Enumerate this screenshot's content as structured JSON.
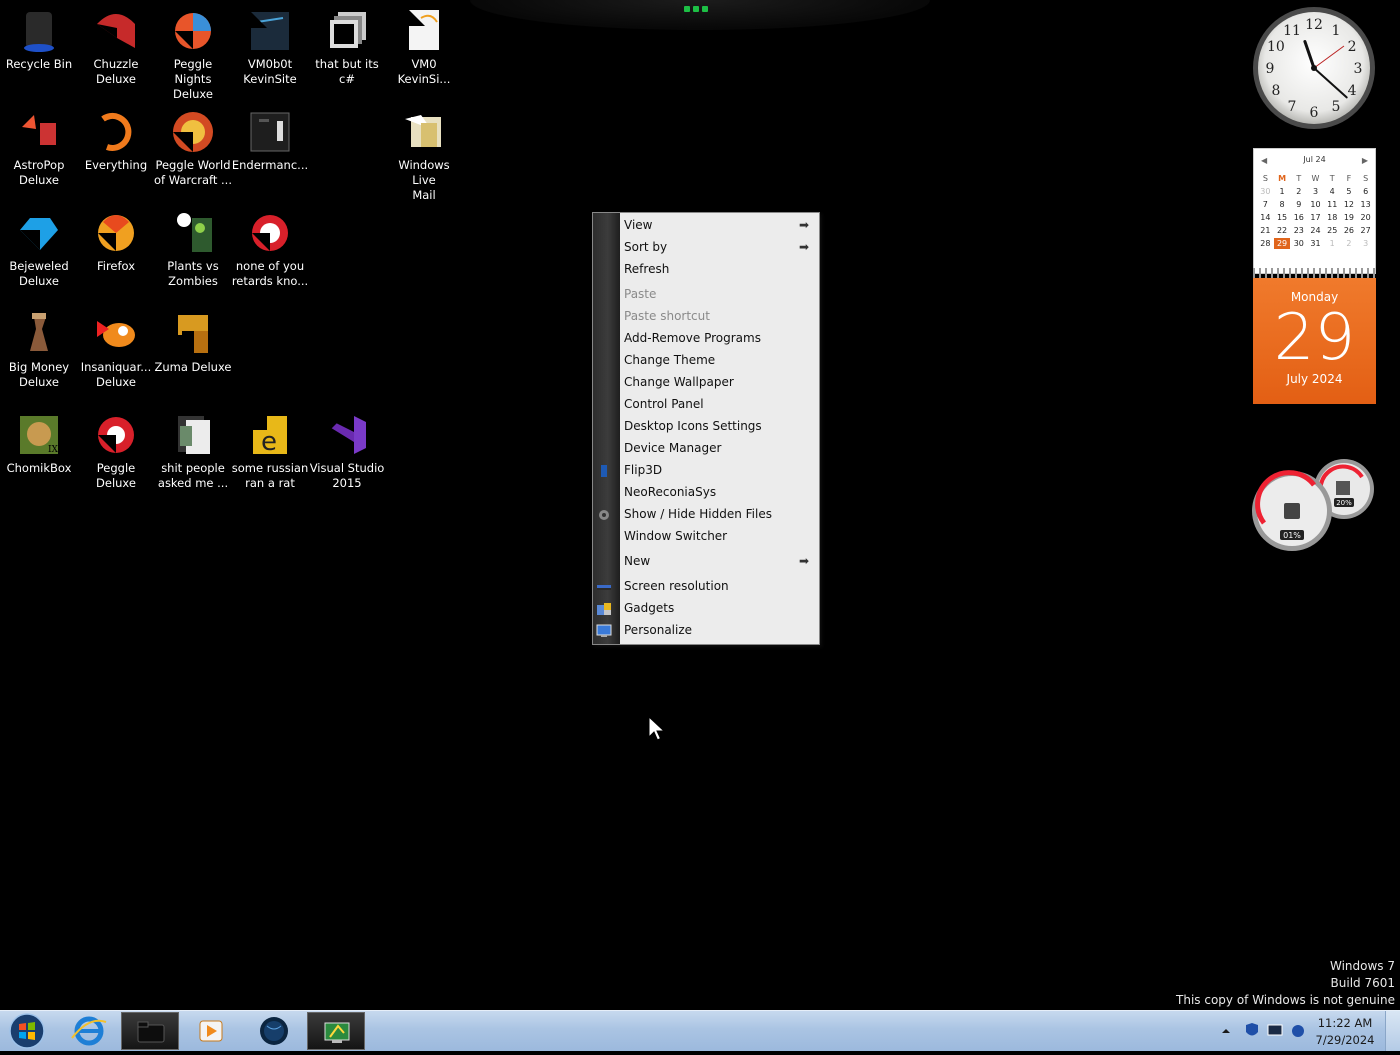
{
  "desktop": {
    "icons": [
      {
        "label": "Recycle Bin",
        "icon": "recycle-bin-icon"
      },
      {
        "label": "Chuzzle\nDeluxe",
        "icon": "chuzzle-icon"
      },
      {
        "label": "Peggle\nNights Deluxe",
        "icon": "peggle-nights-icon"
      },
      {
        "label": "VM0b0t\nKevinSite",
        "icon": "vm0b0t-icon"
      },
      {
        "label": "that but its c#",
        "icon": "folder-stack-icon"
      },
      {
        "label": "VM0\nKevinSi...",
        "icon": "file-icon"
      },
      {
        "label": "AstroPop\nDeluxe",
        "icon": "astropop-icon"
      },
      {
        "label": "Everything",
        "icon": "everything-icon"
      },
      {
        "label": "Peggle World\nof Warcraft ...",
        "icon": "peggle-wow-icon"
      },
      {
        "label": "Endermanc...",
        "icon": "enderman-icon"
      },
      {
        "label": "Windows Live\nMail",
        "icon": "live-mail-icon"
      },
      {
        "label": "Bejeweled\nDeluxe",
        "icon": "bejeweled-icon"
      },
      {
        "label": "Firefox",
        "icon": "firefox-icon"
      },
      {
        "label": "Plants vs\nZombies",
        "icon": "pvz-icon"
      },
      {
        "label": "none of you\nretards kno...",
        "icon": "red-swirl-icon"
      },
      {
        "label": "Big Money\nDeluxe",
        "icon": "big-money-icon"
      },
      {
        "label": "Insaniquar...\nDeluxe",
        "icon": "insaniquarium-icon"
      },
      {
        "label": "Zuma Deluxe",
        "icon": "zuma-icon"
      },
      {
        "label": "ChomikBox",
        "icon": "chomikbox-icon"
      },
      {
        "label": "Peggle\nDeluxe",
        "icon": "peggle-icon"
      },
      {
        "label": "shit people\nasked me ...",
        "icon": "folder-docs-icon"
      },
      {
        "label": "some russian\nran a rat",
        "icon": "russian-rat-icon"
      },
      {
        "label": "Visual Studio\n2015",
        "icon": "visual-studio-icon"
      }
    ]
  },
  "context_menu": {
    "items": [
      {
        "label": "View",
        "submenu": true,
        "disabled": false
      },
      {
        "label": "Sort by",
        "submenu": true,
        "disabled": false
      },
      {
        "label": "Refresh",
        "submenu": false,
        "disabled": false
      },
      {
        "label": "Paste",
        "submenu": false,
        "disabled": true
      },
      {
        "label": "Paste shortcut",
        "submenu": false,
        "disabled": true
      },
      {
        "label": "Add-Remove Programs",
        "submenu": false,
        "disabled": false
      },
      {
        "label": "Change Theme",
        "submenu": false,
        "disabled": false
      },
      {
        "label": "Change Wallpaper",
        "submenu": false,
        "disabled": false
      },
      {
        "label": "Control Panel",
        "submenu": false,
        "disabled": false
      },
      {
        "label": "Desktop Icons Settings",
        "submenu": false,
        "disabled": false
      },
      {
        "label": "Device Manager",
        "submenu": false,
        "disabled": false
      },
      {
        "label": "Flip3D",
        "submenu": false,
        "disabled": false,
        "icon": "flip3d-icon"
      },
      {
        "label": "NeoReconiaSys",
        "submenu": false,
        "disabled": false
      },
      {
        "label": "Show / Hide Hidden Files",
        "submenu": false,
        "disabled": false,
        "icon": "hidden-files-icon"
      },
      {
        "label": "Window Switcher",
        "submenu": false,
        "disabled": false
      },
      {
        "label": "New",
        "submenu": true,
        "disabled": false
      },
      {
        "label": "Screen resolution",
        "submenu": false,
        "disabled": false,
        "icon": "screen-resolution-icon"
      },
      {
        "label": "Gadgets",
        "submenu": false,
        "disabled": false,
        "icon": "gadgets-icon"
      },
      {
        "label": "Personalize",
        "submenu": false,
        "disabled": false,
        "icon": "personalize-icon"
      }
    ],
    "arrow_glyph": "➡"
  },
  "clock_gadget": {
    "numbers": [
      "12",
      "1",
      "2",
      "3",
      "4",
      "5",
      "6",
      "7",
      "8",
      "9",
      "10",
      "11"
    ],
    "time": {
      "hour": 11,
      "minute": 22
    }
  },
  "calendar_gadget": {
    "month_label": "Jul 24",
    "weekdays": [
      "S",
      "M",
      "T",
      "W",
      "T",
      "F",
      "S"
    ],
    "highlight_weekday": 1,
    "weeks": [
      [
        "30",
        "1",
        "2",
        "3",
        "4",
        "5",
        "6"
      ],
      [
        "7",
        "8",
        "9",
        "10",
        "11",
        "12",
        "13"
      ],
      [
        "14",
        "15",
        "16",
        "17",
        "18",
        "19",
        "20"
      ],
      [
        "21",
        "22",
        "23",
        "24",
        "25",
        "26",
        "27"
      ],
      [
        "28",
        "29",
        "30",
        "31",
        "1",
        "2",
        "3"
      ]
    ],
    "today": "29",
    "weekday_name": "Monday",
    "day_number": "29",
    "month_year": "July 2024",
    "accent": "#e0651c"
  },
  "cpu_gadget": {
    "cpu_percent_label": "01%",
    "memory_percent_label": "20%",
    "cpu_percent": 1,
    "memory_percent": 20
  },
  "watermark": {
    "line1": "Windows 7",
    "line2": "Build 7601",
    "line3": "This copy of Windows is not genuine"
  },
  "taskbar": {
    "pinned": [
      {
        "name": "internet-explorer",
        "active": false
      },
      {
        "name": "file-explorer",
        "active": true
      },
      {
        "name": "media-player",
        "active": false
      },
      {
        "name": "globe-app",
        "active": false
      },
      {
        "name": "control-panel-app",
        "active": true
      }
    ],
    "clock": {
      "time": "11:22 AM",
      "date": "7/29/2024"
    }
  }
}
